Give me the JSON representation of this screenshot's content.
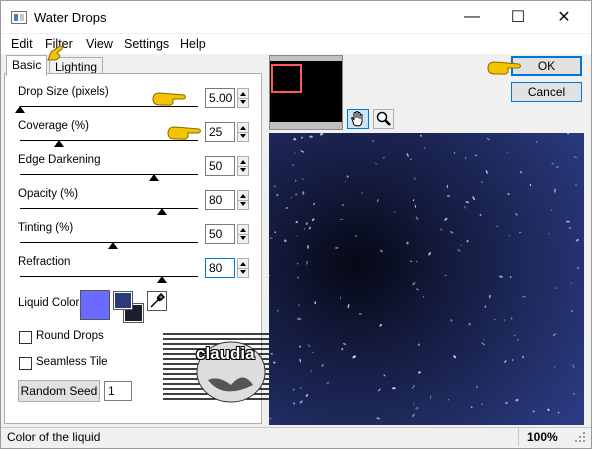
{
  "window": {
    "title": "Water Drops"
  },
  "menu": [
    "Edit",
    "Filter",
    "View",
    "Settings",
    "Help"
  ],
  "tabs": {
    "basic": "Basic",
    "lighting": "Lighting"
  },
  "sliders": [
    {
      "label": "Drop Size (pixels)",
      "value": "5.00",
      "level": 0.0
    },
    {
      "label": "Coverage (%)",
      "value": "25",
      "level": 0.22
    },
    {
      "label": "Edge Darkening",
      "value": "50",
      "level": 0.75
    },
    {
      "label": "Opacity (%)",
      "value": "80",
      "level": 0.8
    },
    {
      "label": "Tinting (%)",
      "value": "50",
      "level": 0.52
    },
    {
      "label": "Refraction",
      "value": "80",
      "level": 0.8
    }
  ],
  "liquid_color": {
    "label": "Liquid Color",
    "swatch": "#6b6bff",
    "foreground": "#2a3a7a",
    "background": "#1e1e2e"
  },
  "checkboxes": {
    "round_drops": "Round Drops",
    "seamless_tile": "Seamless Tile"
  },
  "random_seed": {
    "label": "Random Seed",
    "value": "1"
  },
  "buttons": {
    "ok": "OK",
    "cancel": "Cancel"
  },
  "watermark": {
    "text": "claudia"
  },
  "status": {
    "text": "Color of the liquid",
    "zoom": "100%"
  },
  "colors": {
    "accent": "#0078d7",
    "preview_bg": "#1f2a55",
    "pointer": "#f5c400"
  }
}
